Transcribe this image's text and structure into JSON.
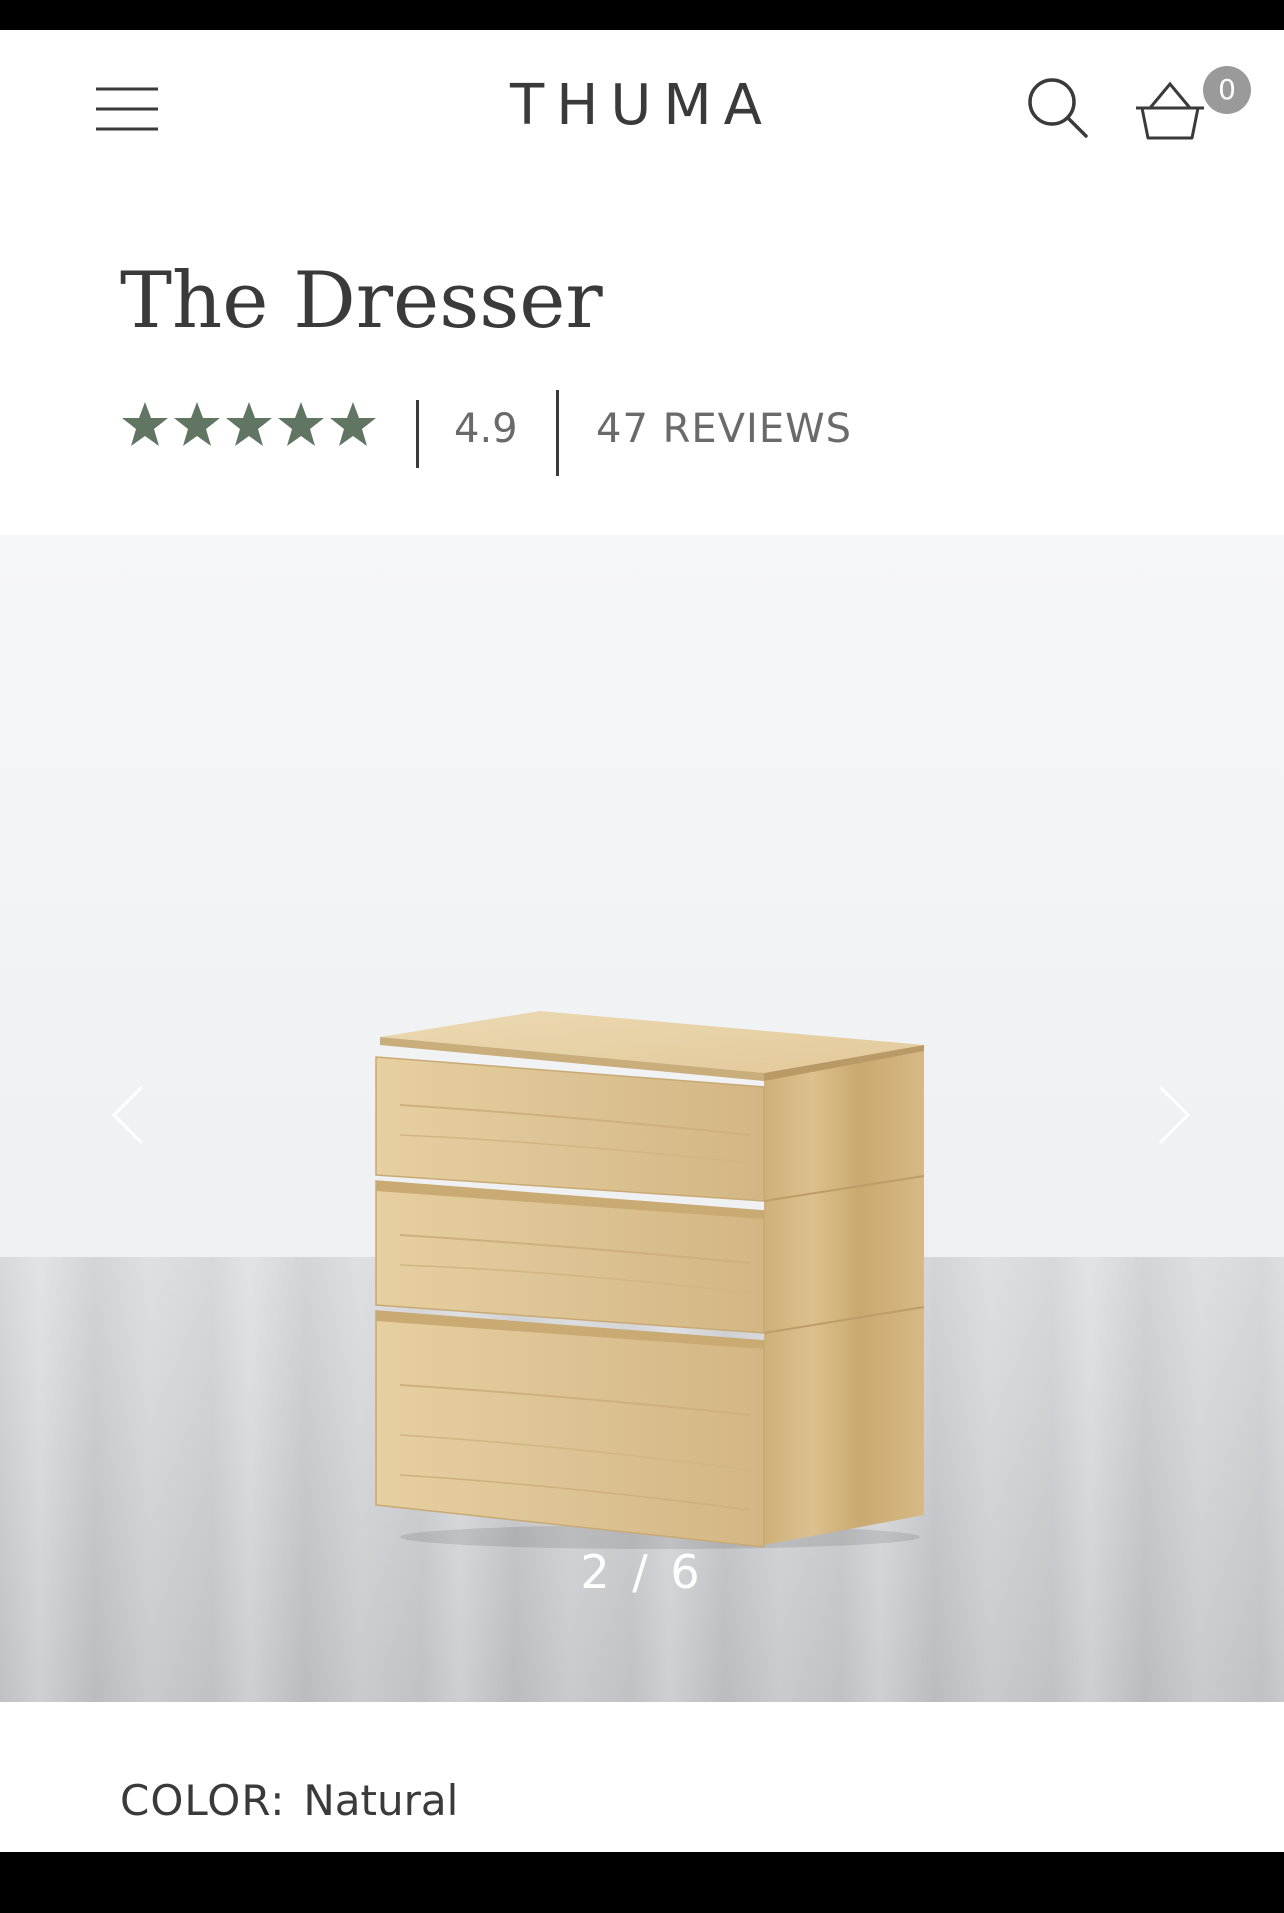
{
  "header": {
    "logo": "THUMA",
    "cart_count": "0"
  },
  "product": {
    "title": "The Dresser",
    "rating": "4.9",
    "rating_stars": 5,
    "reviews": "47 REVIEWS"
  },
  "gallery": {
    "counter": "2 / 6",
    "current": 2,
    "total": 6
  },
  "color": {
    "label": "COLOR:",
    "value": "Natural"
  },
  "colors": {
    "star": "#617563",
    "text": "#3a3a3a",
    "muted": "#6a6a6a",
    "badge": "#9a9a9a"
  },
  "icons": [
    "menu-icon",
    "search-icon",
    "cart-icon",
    "star-icon",
    "chevron-left-icon",
    "chevron-right-icon"
  ]
}
